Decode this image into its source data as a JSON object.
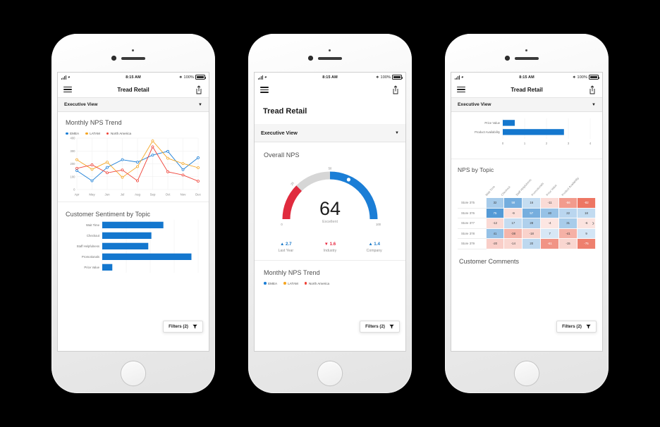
{
  "colors": {
    "blue": "#1b7ed6",
    "orange": "#f5a623",
    "red": "#ef4136",
    "grey": "#d6d6d6",
    "bar_blue": "#1477ce"
  },
  "statusbar": {
    "time": "8:15 AM",
    "battery": "100%"
  },
  "phones": [
    {
      "id": "phone-1",
      "nav": {
        "title": "Tread Retail",
        "menu_icon": "hamburger-icon",
        "share_icon": "share-icon"
      },
      "view_selector": {
        "label": "Executive View",
        "caret": "chevron-down-icon"
      },
      "cards": [
        {
          "title": "Monthly NPS Trend"
        },
        {
          "title": "Customer Sentiment by Topic"
        }
      ],
      "filters": {
        "label": "Filters (2)",
        "icon": "funnel-icon"
      }
    },
    {
      "id": "phone-2",
      "nav": {
        "title": "",
        "menu_icon": "hamburger-icon",
        "share_icon": "share-icon"
      },
      "big_title": "Tread Retail",
      "view_selector": {
        "label": "Executive View",
        "caret": "chevron-down-icon"
      },
      "cards": [
        {
          "title": "Overall NPS"
        },
        {
          "title": "Monthly NPS Trend"
        }
      ],
      "filters": {
        "label": "Filters (2)",
        "icon": "funnel-icon"
      }
    },
    {
      "id": "phone-3",
      "nav": {
        "title": "Tread Retail",
        "menu_icon": "hamburger-icon",
        "share_icon": "share-icon"
      },
      "view_selector": {
        "label": "Executive View",
        "caret": "chevron-down-icon"
      },
      "cards": [
        {
          "title": "NPS by Topic"
        },
        {
          "title": "Customer Comments"
        }
      ],
      "filters": {
        "label": "Filters (2)",
        "icon": "funnel-icon"
      }
    }
  ],
  "chart_data": [
    {
      "id": "monthly-nps-trend",
      "type": "line",
      "title": "Monthly NPS Trend",
      "xlabel": "",
      "ylabel": "",
      "ylim": [
        0,
        400
      ],
      "yticks": [
        0,
        100,
        200,
        300,
        400
      ],
      "grid": true,
      "legend_position": "top",
      "categories": [
        "Apr",
        "May",
        "Jun",
        "Jul",
        "Aug",
        "Sep",
        "Oct",
        "Nov",
        "Dec"
      ],
      "series": [
        {
          "name": "EMEA",
          "color": "#1b7ed6",
          "values": [
            147,
            68,
            172,
            232,
            213,
            268,
            297,
            155,
            247
          ]
        },
        {
          "name": "LATAM",
          "color": "#f5a623",
          "values": [
            232,
            157,
            213,
            95,
            178,
            378,
            243,
            202,
            170
          ]
        },
        {
          "name": "North America",
          "color": "#ef4136",
          "values": [
            165,
            192,
            130,
            152,
            68,
            332,
            138,
            113,
            65
          ]
        }
      ]
    },
    {
      "id": "customer-sentiment-by-topic",
      "type": "bar",
      "orientation": "horizontal",
      "title": "Customer Sentiment by Topic",
      "xlabel": "",
      "ylabel": "",
      "xlim": [
        0,
        4
      ],
      "categories": [
        "Wait Time",
        "Checkout",
        "Staff Helpfulness",
        "Promotionals",
        "Price Value"
      ],
      "values": [
        2.55,
        2.05,
        1.92,
        3.72,
        0.42
      ],
      "color": "#1477ce"
    },
    {
      "id": "overall-nps-gauge",
      "type": "gauge",
      "title": "Overall NPS",
      "value": 64,
      "value_label": "Excellent",
      "min": 0,
      "max": 100,
      "ticks": [
        {
          "label": "0",
          "value": 0
        },
        {
          "label": "25",
          "value": 25
        },
        {
          "label": "50",
          "value": 50
        },
        {
          "label": "100",
          "value": 100
        }
      ],
      "bands": [
        {
          "from": 0,
          "to": 25,
          "color": "#e02b3e"
        },
        {
          "from": 25,
          "to": 50,
          "color": "#d6d6d6"
        },
        {
          "from": 50,
          "to": 100,
          "color": "#1b7ed6"
        }
      ],
      "comparisons": [
        {
          "label": "Last Year",
          "value": "2.7",
          "direction": "up",
          "color": "#1878c8"
        },
        {
          "label": "Industry",
          "value": "1.6",
          "direction": "down",
          "color": "#e8273f"
        },
        {
          "label": "Company",
          "value": "1.4",
          "direction": "up",
          "color": "#1878c8"
        }
      ]
    },
    {
      "id": "topic-bar-partial",
      "type": "bar",
      "orientation": "horizontal",
      "title": "",
      "xlim": [
        0,
        4
      ],
      "xticks": [
        "0",
        "1",
        "2",
        "3",
        "4"
      ],
      "categories": [
        "Price Value",
        "Product Availability"
      ],
      "values": [
        0.55,
        2.8
      ],
      "color": "#1477ce"
    },
    {
      "id": "nps-by-topic-heatmap",
      "type": "heatmap",
      "title": "NPS by Topic",
      "columns": [
        "Wait Time",
        "Checkout",
        "Staff Helpfulness",
        "Promotionals",
        "Price Value",
        "Product Availability"
      ],
      "rows": [
        "Store 375",
        "Store 376",
        "Store 377",
        "Store 378",
        "Store 379"
      ],
      "values": [
        [
          32,
          58,
          16,
          -11,
          -56,
          -82
        ],
        [
          75,
          -9,
          57,
          40,
          22,
          18
        ],
        [
          -12,
          17,
          28,
          -4,
          31,
          -6
        ],
        [
          41,
          -38,
          -18,
          7,
          -41,
          9
        ],
        [
          -20,
          -14,
          20,
          -61,
          -15,
          -75
        ]
      ],
      "scale_min": -90,
      "scale_max": 90,
      "scroll_icon": "chevron-right-icon"
    }
  ]
}
